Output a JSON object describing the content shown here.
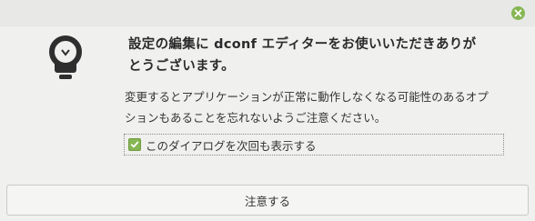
{
  "window": {
    "close_icon": "close-icon",
    "accent_color": "#86b653"
  },
  "notice": {
    "icon": "lightbulb-icon",
    "headline_line1": "設定の編集に dconf エディターをお使いいただきありが",
    "headline_line2": "とうございます。",
    "body_line1": "変更するとアプリケーションが正常に動作しなくなる可能性のあるオプ",
    "body_line2": "ションもあることを忘れないようご注意ください。"
  },
  "checkbox": {
    "label": "このダイアログを次回も表示する",
    "checked": true
  },
  "footer": {
    "confirm_label": "注意する"
  }
}
